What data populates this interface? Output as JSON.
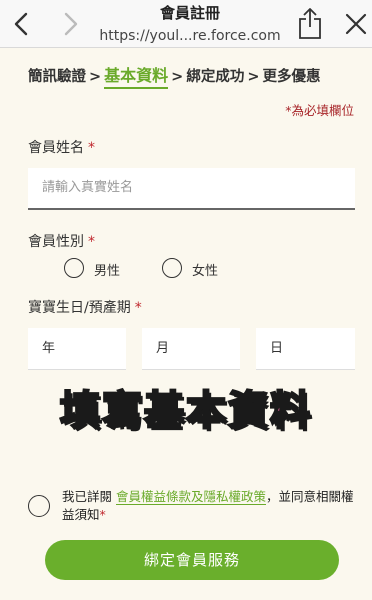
{
  "browser": {
    "title": "會員註冊",
    "url": "https://youl...re.force.com"
  },
  "steps": {
    "step1": "簡訊驗證",
    "step2": "基本資料",
    "step3": "綁定成功",
    "step4": "更多優惠",
    "separator": ">"
  },
  "required_note": "*為必填欄位",
  "form": {
    "name_label": "會員姓名",
    "name_placeholder": "請輸入真實姓名",
    "gender_label": "會員性別",
    "gender_male": "男性",
    "gender_female": "女性",
    "birth_label": "寶寶生日/預產期",
    "year": "年",
    "month": "月",
    "day": "日",
    "required_star": "*"
  },
  "overlay_text": "填寫基本資料",
  "agreement": {
    "prefix": "我已詳閱",
    "link": "會員權益條款及隱私權政策",
    "suffix": "，並同意相關權益須知",
    "star": "*"
  },
  "submit_label": "綁定會員服務",
  "colors": {
    "accent": "#6aaf2c",
    "required": "#c0282e",
    "background": "#fbf8ee",
    "overlay_fill": "#ff6fae"
  }
}
